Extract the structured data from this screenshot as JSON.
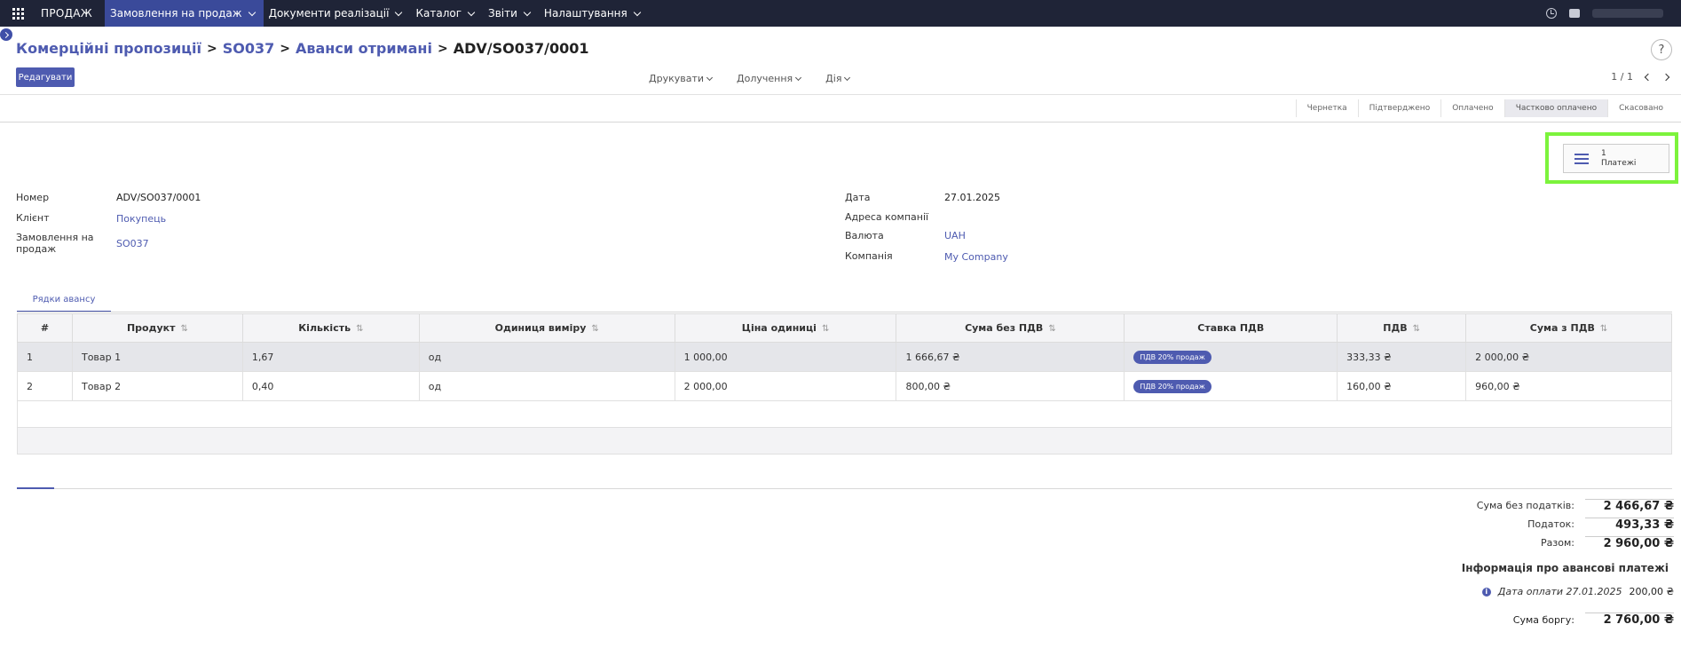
{
  "navbar": {
    "app_name": "ПРОДАЖ",
    "menu": [
      "Замовлення на продаж",
      "Документи реалізації",
      "Каталог",
      "Звіти",
      "Налаштування"
    ]
  },
  "breadcrumb": {
    "items": [
      "Комерційні пропозиції",
      "SO037",
      "Аванси отримані"
    ],
    "current": "ADV/SO037/0001",
    "separator": ">"
  },
  "help_label": "?",
  "controls": {
    "edit_label": "Редагувати",
    "print_label": "Друкувати",
    "attach_label": "Долучення",
    "action_label": "Дія",
    "pager": "1 / 1"
  },
  "stages": [
    "Чернетка",
    "Підтверджено",
    "Оплачено",
    "Частково оплачено",
    "Скасовано"
  ],
  "smart_button": {
    "count": "1",
    "label": "Платежі"
  },
  "form": {
    "number_label": "Номер",
    "number_value": "ADV/SO037/0001",
    "client_label": "Клієнт",
    "client_value": "Покупець",
    "order_label": "Замовлення на продаж",
    "order_value": "SO037",
    "date_label": "Дата",
    "date_value": "27.01.2025",
    "address_label": "Адреса компанії",
    "currency_label": "Валюта",
    "currency_value": "UAH",
    "company_label": "Компанія",
    "company_value": "My Company"
  },
  "tab_label": "Рядки авансу",
  "table": {
    "headers": [
      "#",
      "Продукт",
      "Кількість",
      "Одиниця виміру",
      "Ціна одиниці",
      "Сума без ПДВ",
      "Ставка ПДВ",
      "ПДВ",
      "Сума з ПДВ"
    ],
    "rows": [
      {
        "n": "1",
        "product": "Товар 1",
        "qty": "1,67",
        "uom": "од",
        "price": "1 000,00",
        "subtotal": "1 666,67 ₴",
        "tax": "ПДВ 20% продаж",
        "vat": "333,33 ₴",
        "total": "2 000,00 ₴"
      },
      {
        "n": "2",
        "product": "Товар 2",
        "qty": "0,40",
        "uom": "од",
        "price": "2 000,00",
        "subtotal": "800,00 ₴",
        "tax": "ПДВ 20% продаж",
        "vat": "160,00 ₴",
        "total": "960,00 ₴"
      }
    ]
  },
  "totals": {
    "untaxed_label": "Сума без податків:",
    "untaxed_value": "2 466,67 ₴",
    "tax_label": "Податок:",
    "tax_value": "493,33 ₴",
    "total_label": "Разом:",
    "total_value": "2 960,00 ₴"
  },
  "advance": {
    "title": "Інформація про авансові платежі",
    "payment_date": "Дата оплати 27.01.2025",
    "payment_amount": "200,00 ₴",
    "debt_label": "Сума боргу:",
    "debt_value": "2 760,00 ₴"
  },
  "colors": {
    "navbar": "#1f2437",
    "accent": "#4e5bb0",
    "highlight_frame": "#7cf33c"
  }
}
